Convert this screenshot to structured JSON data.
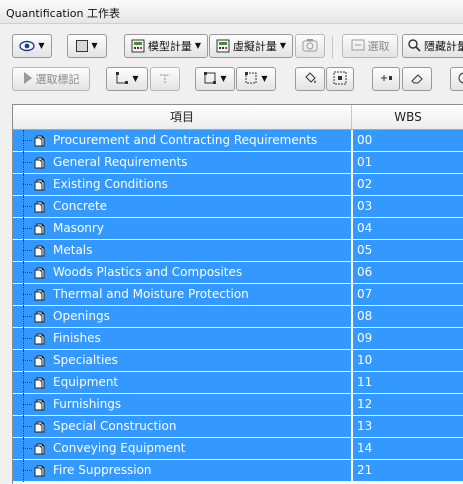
{
  "window": {
    "title": "Quantification 工作表"
  },
  "toolbar1": {
    "model_takeoff": "模型計量",
    "virtual_takeoff": "虛擬計量",
    "select": "選取",
    "hide": "隱藏計量"
  },
  "toolbar2": {
    "select_takeoff": "選取標記"
  },
  "grid": {
    "columns": [
      "項目",
      "WBS"
    ],
    "rows": [
      {
        "item": "Procurement and Contracting Requirements",
        "wbs": "00"
      },
      {
        "item": "General Requirements",
        "wbs": "01"
      },
      {
        "item": "Existing Conditions",
        "wbs": "02"
      },
      {
        "item": "Concrete",
        "wbs": "03"
      },
      {
        "item": "Masonry",
        "wbs": "04"
      },
      {
        "item": "Metals",
        "wbs": "05"
      },
      {
        "item": "Woods Plastics and Composites",
        "wbs": "06"
      },
      {
        "item": "Thermal and Moisture Protection",
        "wbs": "07"
      },
      {
        "item": "Openings",
        "wbs": "08"
      },
      {
        "item": "Finishes",
        "wbs": "09"
      },
      {
        "item": "Specialties",
        "wbs": "10"
      },
      {
        "item": "Equipment",
        "wbs": "11"
      },
      {
        "item": "Furnishings",
        "wbs": "12"
      },
      {
        "item": "Special Construction",
        "wbs": "13"
      },
      {
        "item": "Conveying Equipment",
        "wbs": "14"
      },
      {
        "item": "Fire Suppression",
        "wbs": "21"
      }
    ]
  },
  "colors": {
    "selection": "#3399ff",
    "selection_text": "#ffffff"
  },
  "icons": {
    "view": "eye-icon",
    "display": "square-icon",
    "model": "calculator-icon",
    "virtual": "calculator-icon",
    "refresh": "camera-icon",
    "folder": "folder-icon"
  }
}
